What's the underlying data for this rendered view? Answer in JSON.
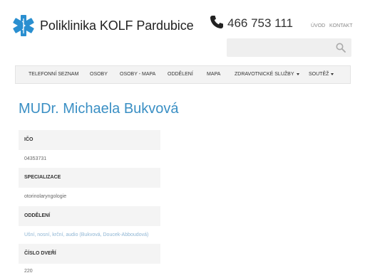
{
  "brand": {
    "logo_icon": "star-of-life-icon",
    "title": "Poliklinika KOLF Pardubice",
    "accent_color": "#2a8fd0"
  },
  "contact": {
    "phone_icon": "phone-icon",
    "phone": "466 753 111"
  },
  "top_links": [
    "ÚVOD",
    "KONTAKT"
  ],
  "search": {
    "icon": "search-icon"
  },
  "nav": {
    "items": [
      {
        "label": "TELEFONNÍ SEZNAM"
      },
      {
        "label": "OSOBY"
      },
      {
        "label": "OSOBY - MAPA"
      },
      {
        "label": "ODDĚLENÍ"
      },
      {
        "label": "MAPA"
      },
      {
        "label": "ZDRAVOTNICKÉ SLUŽBY",
        "dropdown": true
      },
      {
        "label": "SOUTĚŽ",
        "dropdown": true
      }
    ]
  },
  "page_title": "MUDr. Michaela Bukvová",
  "fields": [
    {
      "label": "IČO",
      "value": "04353731"
    },
    {
      "label": "SPECIALIZACE",
      "value": "otorinolaryngologie"
    },
    {
      "label": "ODDĚLENÍ",
      "value": "Ušní, nosní, krční, audio (Bukvová, Doucek-Abboudová)"
    },
    {
      "label": "ČÍSLO DVEŘÍ",
      "value": "220"
    }
  ]
}
